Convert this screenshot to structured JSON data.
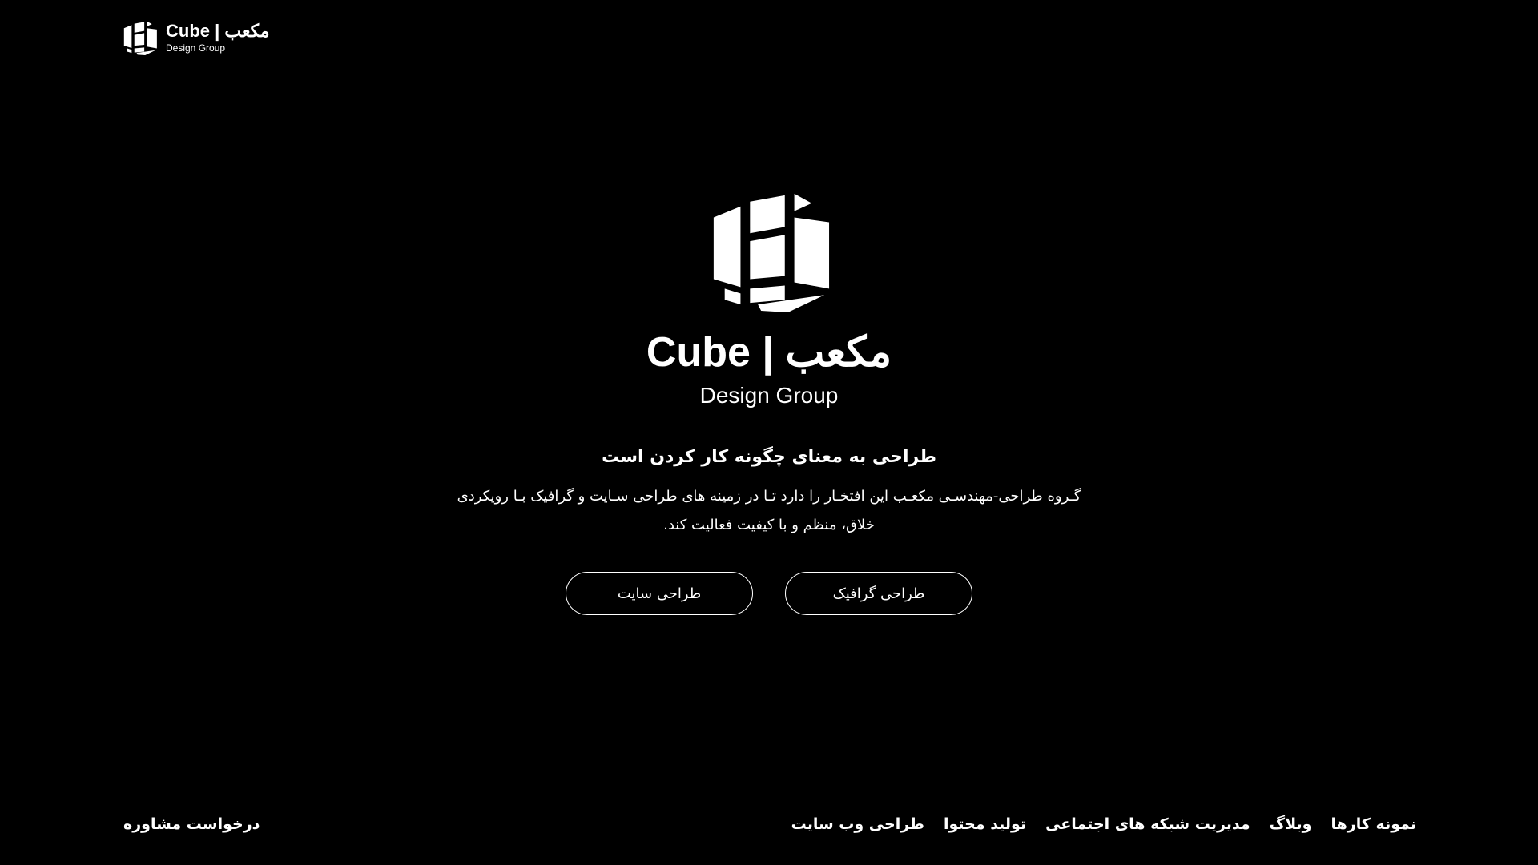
{
  "header": {
    "brand": "Cube | مکعب",
    "tagline": "Design Group"
  },
  "hero": {
    "brand": "Cube | مکعب",
    "tagline": "Design Group",
    "headline": "طراحی به معنای چگونه کار کردن است",
    "description": "گـروه طراحی-مهندسـی مکعـب این افتخـار را دارد تـا در زمینه های طراحی سـایت و گرافیک بـا رویکردی خلاق، منظم و با کیفیت فعالیت کند.",
    "buttons": {
      "site_design": "طراحی سایت",
      "graphic_design": "طراحی گرافیک"
    }
  },
  "footer": {
    "nav": [
      "طراحی وب سایت",
      "تولید محتوا",
      "مدیریت شبکه های اجتماعی",
      "وبلاگ",
      "نمونه کارها"
    ],
    "cta": "درخواست مشاوره"
  },
  "colors": {
    "background": "#000000",
    "foreground": "#ffffff"
  }
}
